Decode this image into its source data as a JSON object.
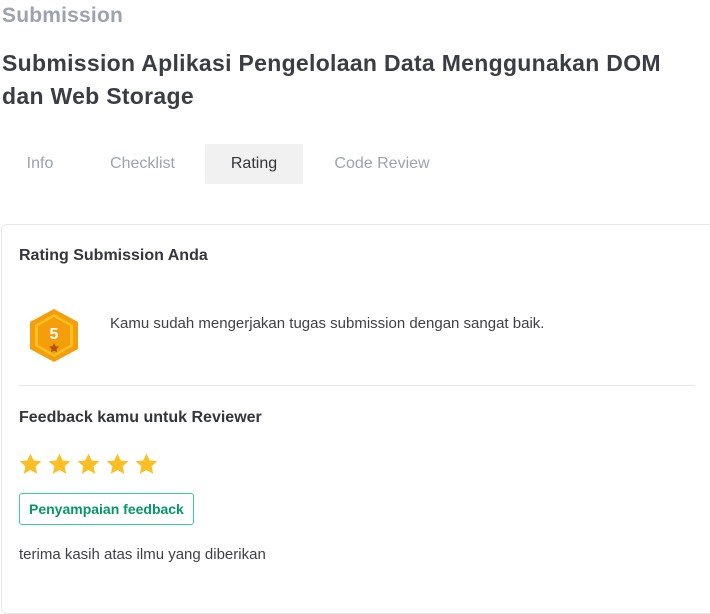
{
  "header": {
    "eyebrow": "Submission",
    "title": "Submission Aplikasi Pengelolaan Data Menggunakan DOM dan Web Storage"
  },
  "tabs": [
    {
      "label": "Info",
      "active": false
    },
    {
      "label": "Checklist",
      "active": false
    },
    {
      "label": "Rating",
      "active": true
    },
    {
      "label": "Code Review",
      "active": false
    }
  ],
  "rating": {
    "heading": "Rating Submission Anda",
    "badge_value": "5",
    "message": "Kamu sudah mengerjakan tugas submission dengan sangat baik."
  },
  "feedback": {
    "heading": "Feedback kamu untuk Reviewer",
    "stars": 5,
    "max_stars": 5,
    "tag": "Penyampaian feedback",
    "comment": "terima kasih atas ilmu yang diberikan"
  },
  "colors": {
    "badge_fill": "#f5a623",
    "star": "#fbbf24",
    "tag_border": "#34d399",
    "tag_text": "#059669"
  }
}
